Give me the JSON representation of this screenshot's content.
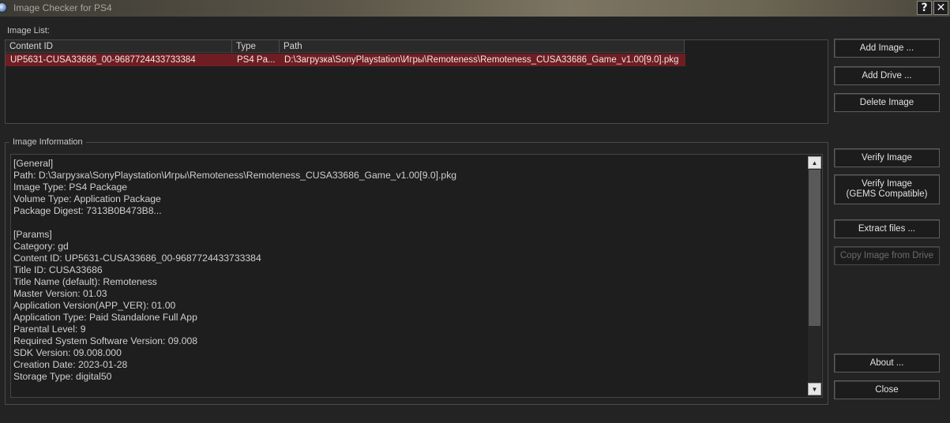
{
  "window": {
    "title": "Image Checker for PS4",
    "help_label": "?",
    "close_label": "✕"
  },
  "image_list": {
    "label": "Image List:",
    "columns": [
      "Content ID",
      "Type",
      "Path"
    ],
    "rows": [
      {
        "content_id": "UP5631-CUSA33686_00-9687724433733384",
        "type": "PS4 Pa...",
        "path": "D:\\Загрузка\\SonyPlaystation\\Игры\\Remoteness\\Remoteness_CUSA33686_Game_v1.00[9.0].pkg"
      }
    ]
  },
  "image_information": {
    "label": "Image Information",
    "lines": [
      "[General]",
      "Path: D:\\Загрузка\\SonyPlaystation\\Игры\\Remoteness\\Remoteness_CUSA33686_Game_v1.00[9.0].pkg",
      "Image Type: PS4 Package",
      "Volume Type: Application Package",
      "Package Digest: 7313B0B473B8...",
      "",
      "[Params]",
      "Category: gd",
      "Content ID: UP5631-CUSA33686_00-9687724433733384",
      "Title ID: CUSA33686",
      "Title Name (default): Remoteness",
      "Master Version: 01.03",
      "Application Version(APP_VER): 01.00",
      "Application Type: Paid Standalone Full App",
      "Parental Level: 9",
      "Required System Software Version: 09.008",
      "SDK Version: 09.008.000",
      "Creation Date: 2023-01-28",
      "Storage Type: digital50"
    ]
  },
  "buttons": {
    "add_image": "Add Image ...",
    "add_drive": "Add Drive ...",
    "delete_image": "Delete Image",
    "verify_image": "Verify Image",
    "verify_image_gems_line1": "Verify Image",
    "verify_image_gems_line2": "(GEMS Compatible)",
    "extract_files": "Extract files ...",
    "copy_image_from_drive": "Copy Image from Drive",
    "about": "About ...",
    "close": "Close"
  },
  "colors": {
    "background": "#232323",
    "selected_row": "#6e1e22",
    "panel": "#1e1e1e"
  }
}
